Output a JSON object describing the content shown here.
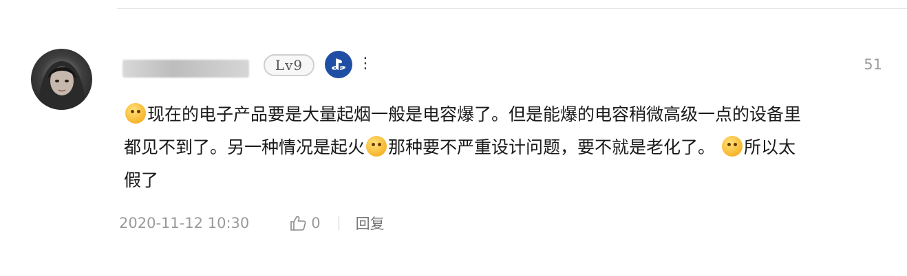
{
  "comment": {
    "level_badge": "Lv9",
    "floor": "51",
    "content_lines": [
      "现在的电子产品要是大量起烟一般是电容爆了。但是能爆的电容稍微高级一点的设备里",
      "都见不到了。另一种情况是起火",
      "那种要不严重设计问题，要不就是老化了。",
      "所以太",
      "假了"
    ],
    "timestamp": "2020-11-12 10:30",
    "like_count": "0",
    "reply_label": "回复",
    "more_label": "⋮"
  },
  "icons": {
    "platform_badge": "playstation-icon",
    "like": "thumbs-up-icon",
    "emojis": [
      "hungry-emoji-icon",
      "crying-emoji-icon",
      "laughing-emoji-icon"
    ]
  },
  "colors": {
    "platform_badge": "#1f4fa5",
    "muted_text": "#9a9a9a"
  }
}
